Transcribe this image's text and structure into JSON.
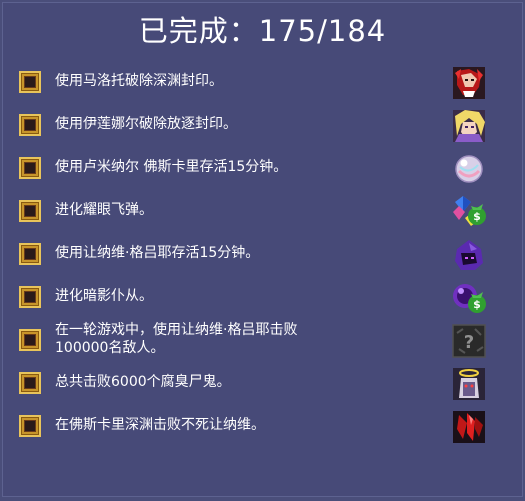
{
  "header": {
    "label": "已完成",
    "separator": "：",
    "progress": "175/184"
  },
  "achievements": [
    {
      "text": "使用马洛托破除深渊封印。",
      "icon": "red-haired-character-icon"
    },
    {
      "text": "使用伊莲娜尔破除放逐封印。",
      "icon": "blonde-character-icon"
    },
    {
      "text": "使用卢米纳尔 佛斯卡里存活15分钟。",
      "icon": "pearl-orb-icon"
    },
    {
      "text": "进化耀眼飞弹。",
      "icon": "gem-money-bag-icon"
    },
    {
      "text": "使用让纳维·格吕耶存活15分钟。",
      "icon": "purple-hooded-character-icon"
    },
    {
      "text": "进化暗影仆从。",
      "icon": "purple-orb-money-bag-icon"
    },
    {
      "text": "在一轮游戏中，使用让纳维·格吕耶击败\n100000名敌人。",
      "icon": "locked-question-icon"
    },
    {
      "text": "总共击败6000个腐臭尸鬼。",
      "icon": "angel-ghoul-icon"
    },
    {
      "text": "在佛斯卡里深渊击败不死让纳维。",
      "icon": "red-claw-icon"
    }
  ],
  "colors": {
    "background": "#474a78",
    "text": "#ffffff",
    "checkbox_frame": "#c8952a",
    "checkbox_fill": "#2a1a1a"
  }
}
